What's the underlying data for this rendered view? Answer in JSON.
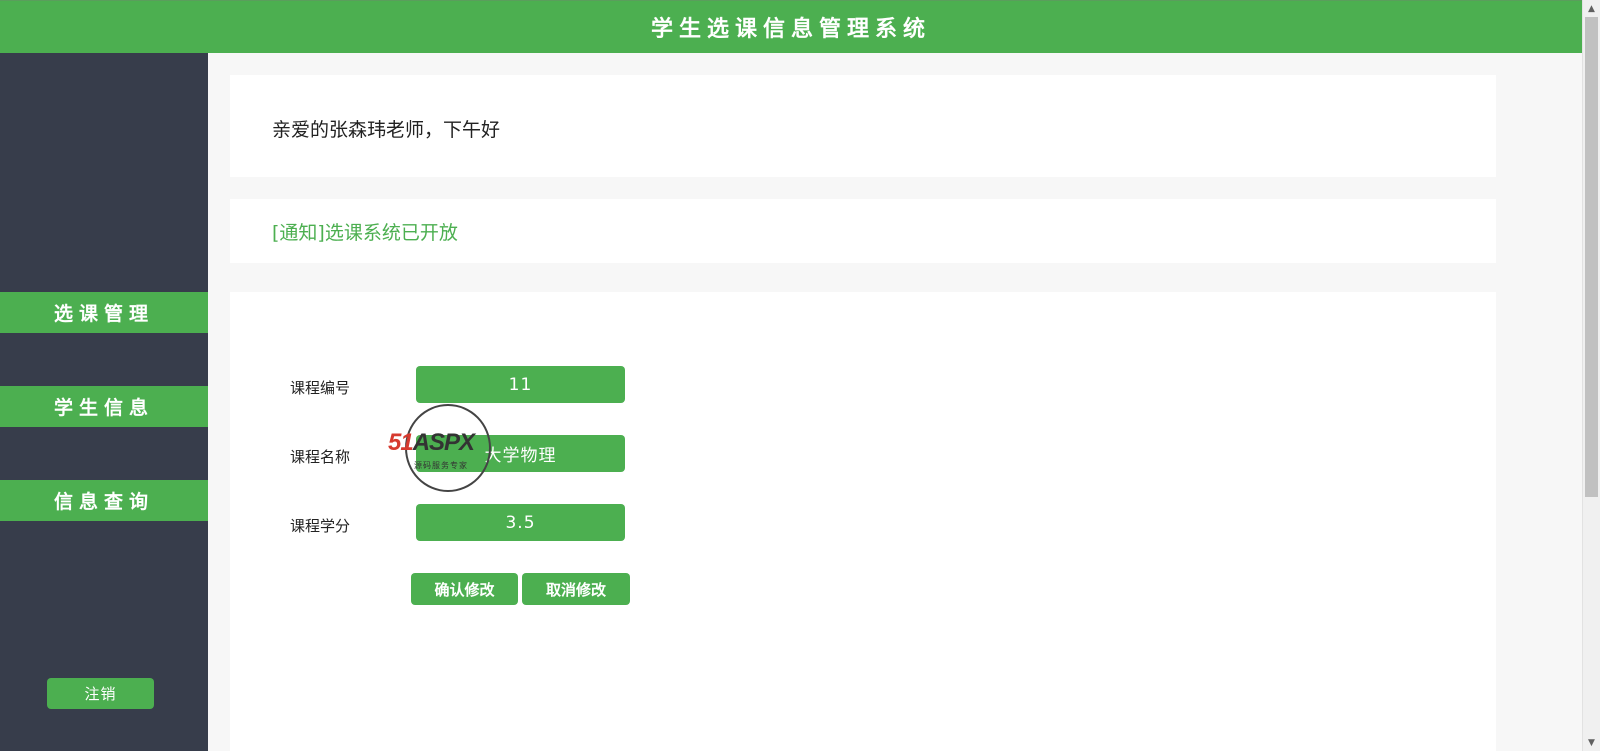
{
  "header": {
    "title": "学生选课信息管理系统"
  },
  "sidebar": {
    "items": [
      {
        "label": "选课管理"
      },
      {
        "label": "学生信息"
      },
      {
        "label": "信息查询"
      }
    ],
    "logout_label": "注销"
  },
  "main": {
    "greeting": "亲爱的张森玮老师，下午好",
    "notice": "[通知]选课系统已开放",
    "form": {
      "fields": [
        {
          "label": "课程编号",
          "value": "11"
        },
        {
          "label": "课程名称",
          "value": "大学物理"
        },
        {
          "label": "课程学分",
          "value": "3.5"
        }
      ],
      "confirm_label": "确认修改",
      "cancel_label": "取消修改"
    }
  },
  "watermark": {
    "brand_red": "51",
    "brand_dark": "ASPX",
    "subtitle": "源码服务专家"
  },
  "colors": {
    "accent": "#4caf50",
    "sidebar_bg": "#373d4b",
    "content_bg": "#f7f7f7"
  }
}
